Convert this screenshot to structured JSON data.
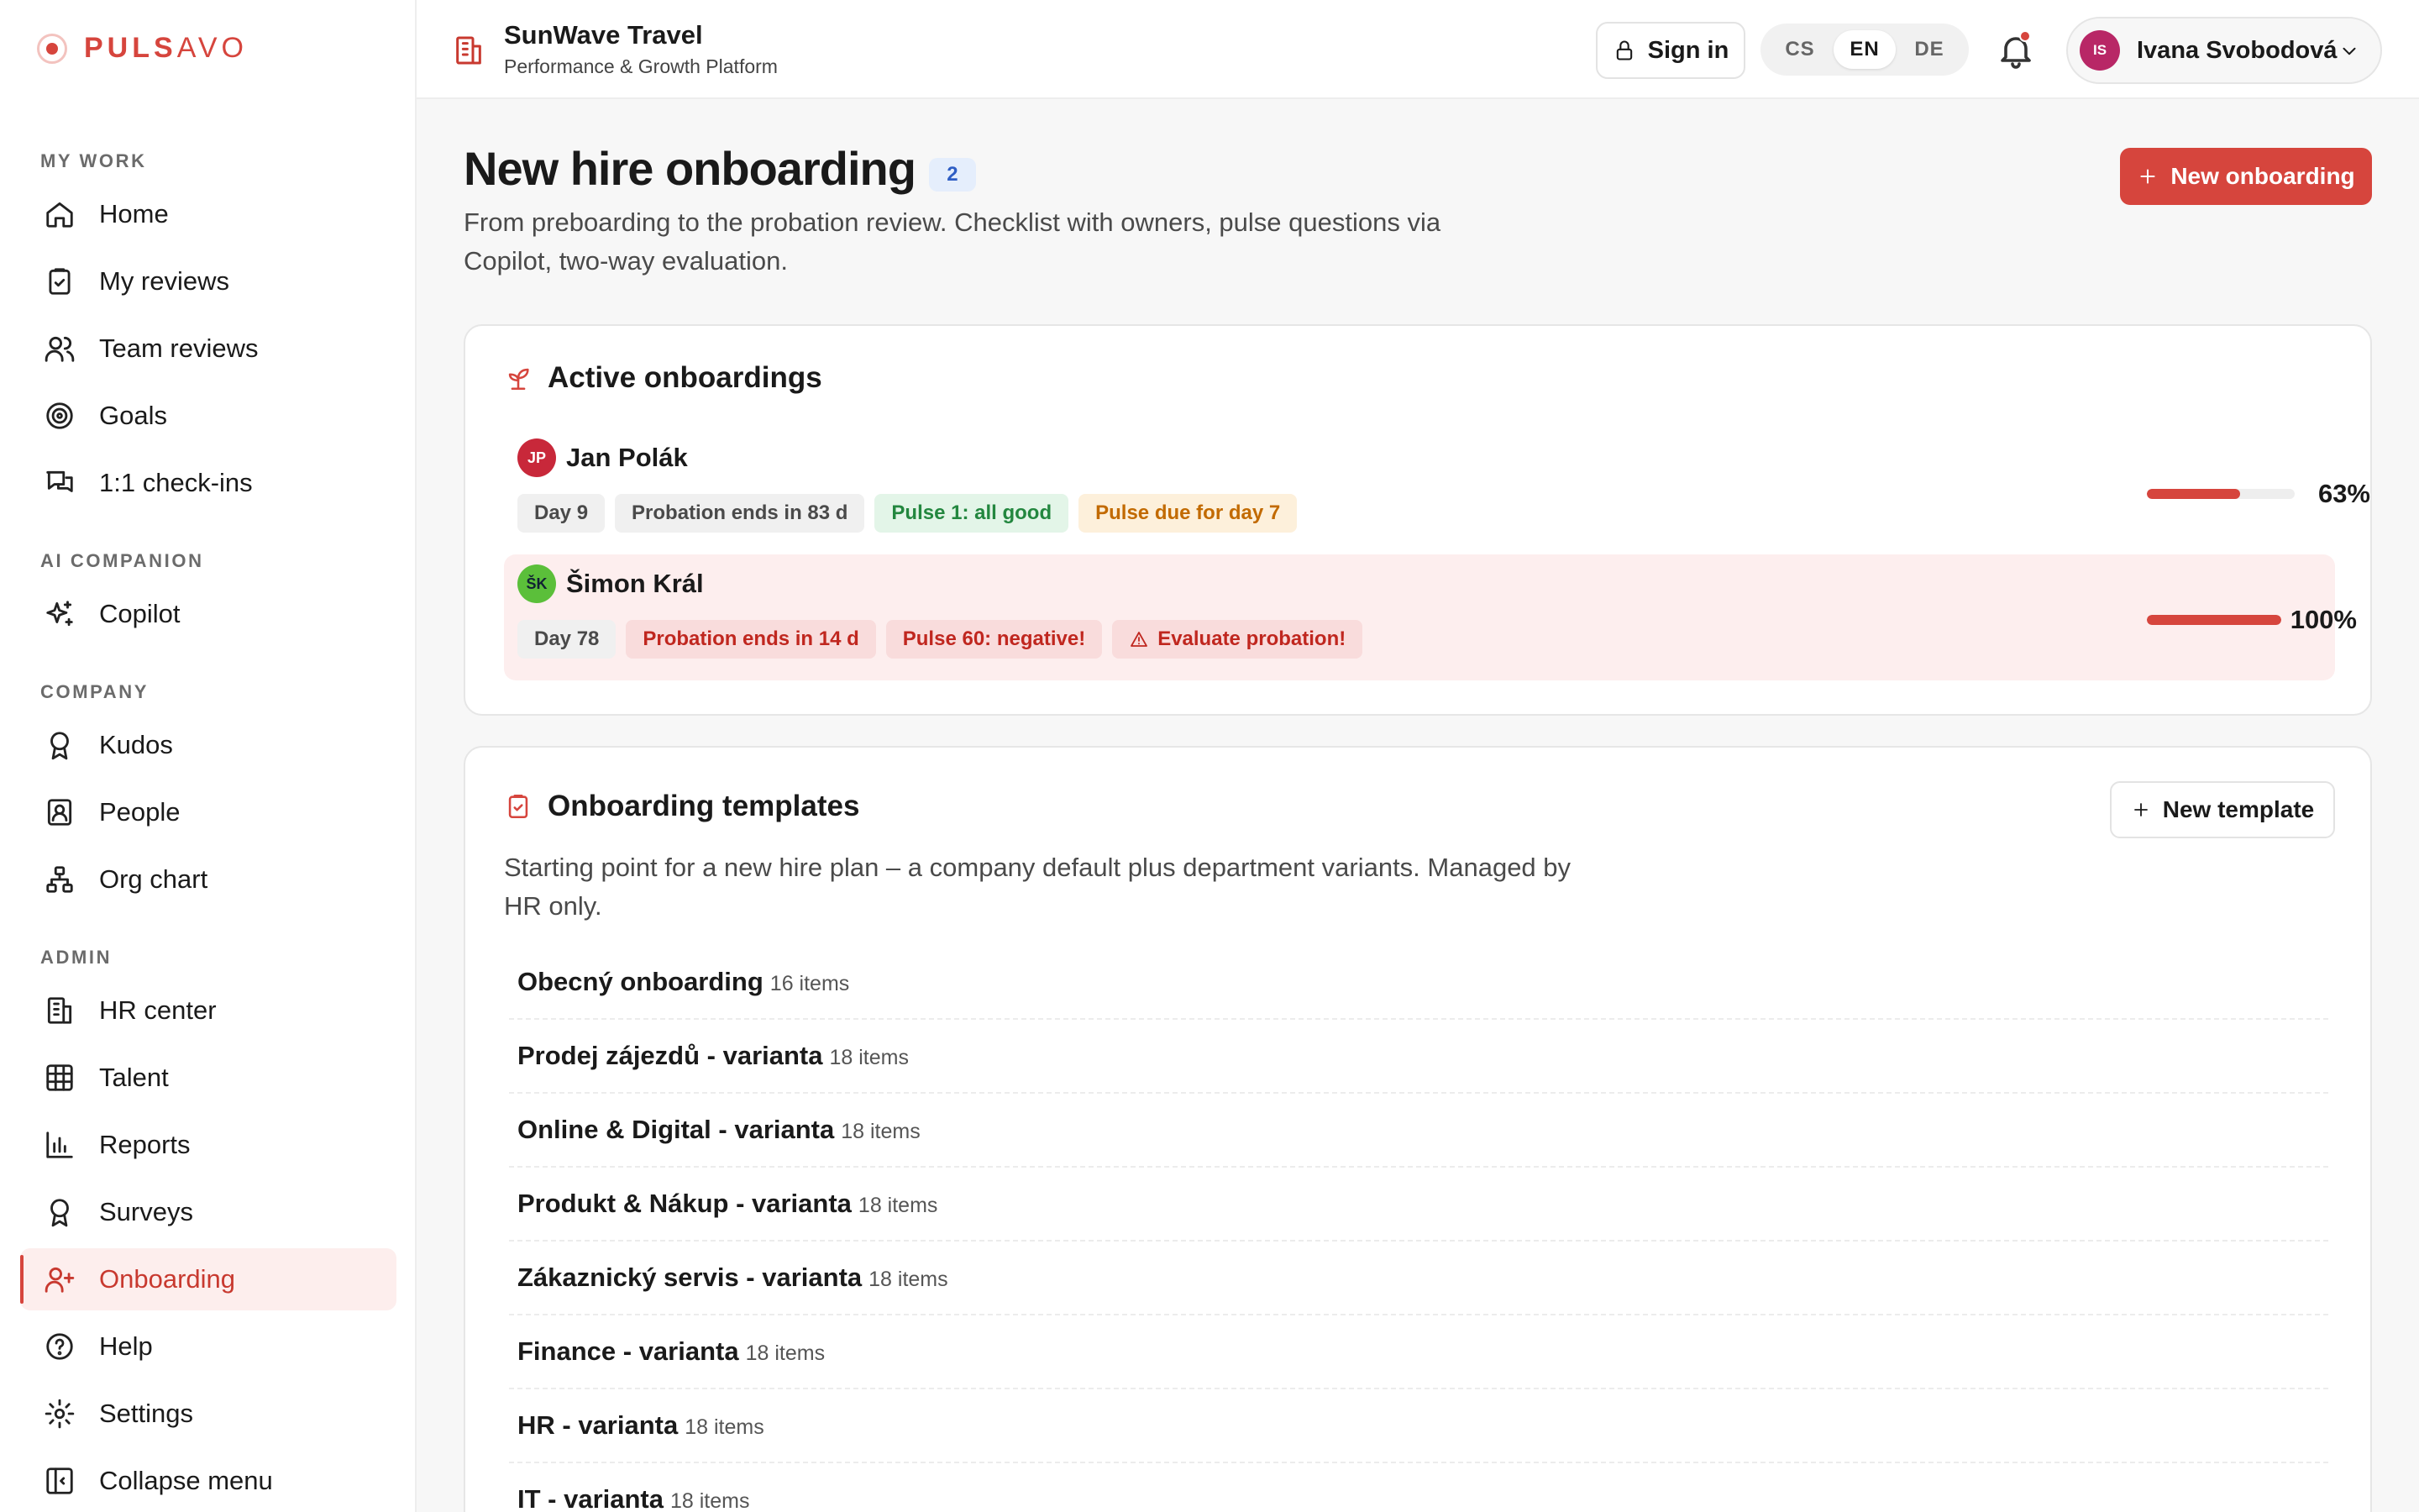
{
  "brand": {
    "name_bold": "PULS",
    "name_light": "AVO",
    "accent": "#d6453d"
  },
  "topbar": {
    "company_name": "SunWave Travel",
    "company_sub": "Performance & Growth Platform",
    "sign_in": "Sign in",
    "languages": [
      "CS",
      "EN",
      "DE"
    ],
    "active_language": "EN",
    "user": {
      "initials": "IS",
      "name": "Ivana Svobodová"
    }
  },
  "sidebar": {
    "sections": {
      "my_work": "MY WORK",
      "ai": "AI COMPANION",
      "company": "COMPANY",
      "admin": "ADMIN"
    },
    "items": {
      "home": "Home",
      "my_reviews": "My reviews",
      "team_reviews": "Team reviews",
      "goals": "Goals",
      "checkins": "1:1 check-ins",
      "copilot": "Copilot",
      "kudos": "Kudos",
      "people": "People",
      "org_chart": "Org chart",
      "hr_center": "HR center",
      "talent": "Talent",
      "reports": "Reports",
      "surveys": "Surveys",
      "onboarding": "Onboarding",
      "help": "Help",
      "settings": "Settings",
      "collapse": "Collapse menu"
    }
  },
  "page": {
    "title": "New hire onboarding",
    "count": "2",
    "description": "From preboarding to the probation review. Checklist with owners, pulse questions via Copilot, two-way evaluation.",
    "new_button": "New onboarding"
  },
  "active": {
    "title": "Active onboardings",
    "rows": [
      {
        "initials": "JP",
        "name": "Jan Polák",
        "avatar_color": "#c8283a",
        "tags": [
          "Day 9",
          "Probation ends in 83 d",
          "Pulse 1: all good",
          "Pulse due for day 7"
        ],
        "progress": 0.63,
        "progress_label": "63%"
      },
      {
        "initials": "ŠK",
        "name": "Šimon Král",
        "avatar_color": "#5bbf3a",
        "tags": [
          "Day 78",
          "Probation ends in 14 d",
          "Pulse 60: negative!",
          "Evaluate probation!"
        ],
        "progress": 1.0,
        "progress_label": "100%"
      }
    ]
  },
  "templates": {
    "title": "Onboarding templates",
    "new_button": "New template",
    "description": "Starting point for a new hire plan – a company default plus department variants. Managed by HR only.",
    "items": [
      {
        "name": "Obecný onboarding",
        "count": "16 items"
      },
      {
        "name": "Prodej zájezdů - varianta",
        "count": "18 items"
      },
      {
        "name": "Online & Digital - varianta",
        "count": "18 items"
      },
      {
        "name": "Produkt & Nákup - varianta",
        "count": "18 items"
      },
      {
        "name": "Zákaznický servis - varianta",
        "count": "18 items"
      },
      {
        "name": "Finance - varianta",
        "count": "18 items"
      },
      {
        "name": "HR - varianta",
        "count": "18 items"
      },
      {
        "name": "IT - varianta",
        "count": "18 items"
      }
    ]
  }
}
